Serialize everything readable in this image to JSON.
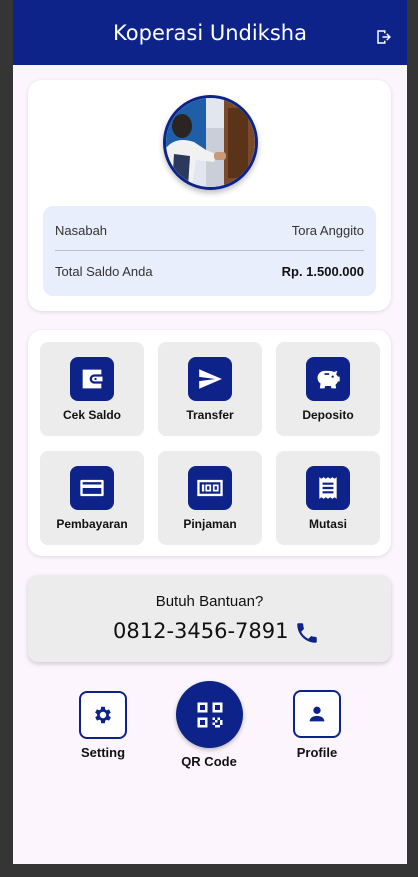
{
  "app": {
    "title": "Koperasi Undiksha"
  },
  "icons": {
    "logout": "logout-icon",
    "wallet": "wallet-icon",
    "send": "send-icon",
    "piggy": "piggy-bank-icon",
    "card": "credit-card-icon",
    "loan": "pinjaman-icon",
    "receipt": "receipt-icon",
    "phone": "phone-icon",
    "gear": "gear-icon",
    "qr": "qr-code-icon",
    "person": "person-icon"
  },
  "colors": {
    "primary": "#0d238a",
    "background": "#fcf5fd",
    "info_bg": "#e8eefc",
    "tile_bg": "#ececec"
  },
  "profile": {
    "name_label": "Nasabah",
    "name_value": "Tora Anggito",
    "balance_label": "Total Saldo Anda",
    "balance_value": "Rp. 1.500.000"
  },
  "menu": [
    {
      "label": "Cek Saldo"
    },
    {
      "label": "Transfer"
    },
    {
      "label": "Deposito"
    },
    {
      "label": "Pembayaran"
    },
    {
      "label": "Pinjaman"
    },
    {
      "label": "Mutasi"
    }
  ],
  "help": {
    "title": "Butuh Bantuan?",
    "phone": "0812-3456-7891"
  },
  "bottom_nav": {
    "setting": "Setting",
    "qr": "QR Code",
    "profile": "Profile"
  }
}
